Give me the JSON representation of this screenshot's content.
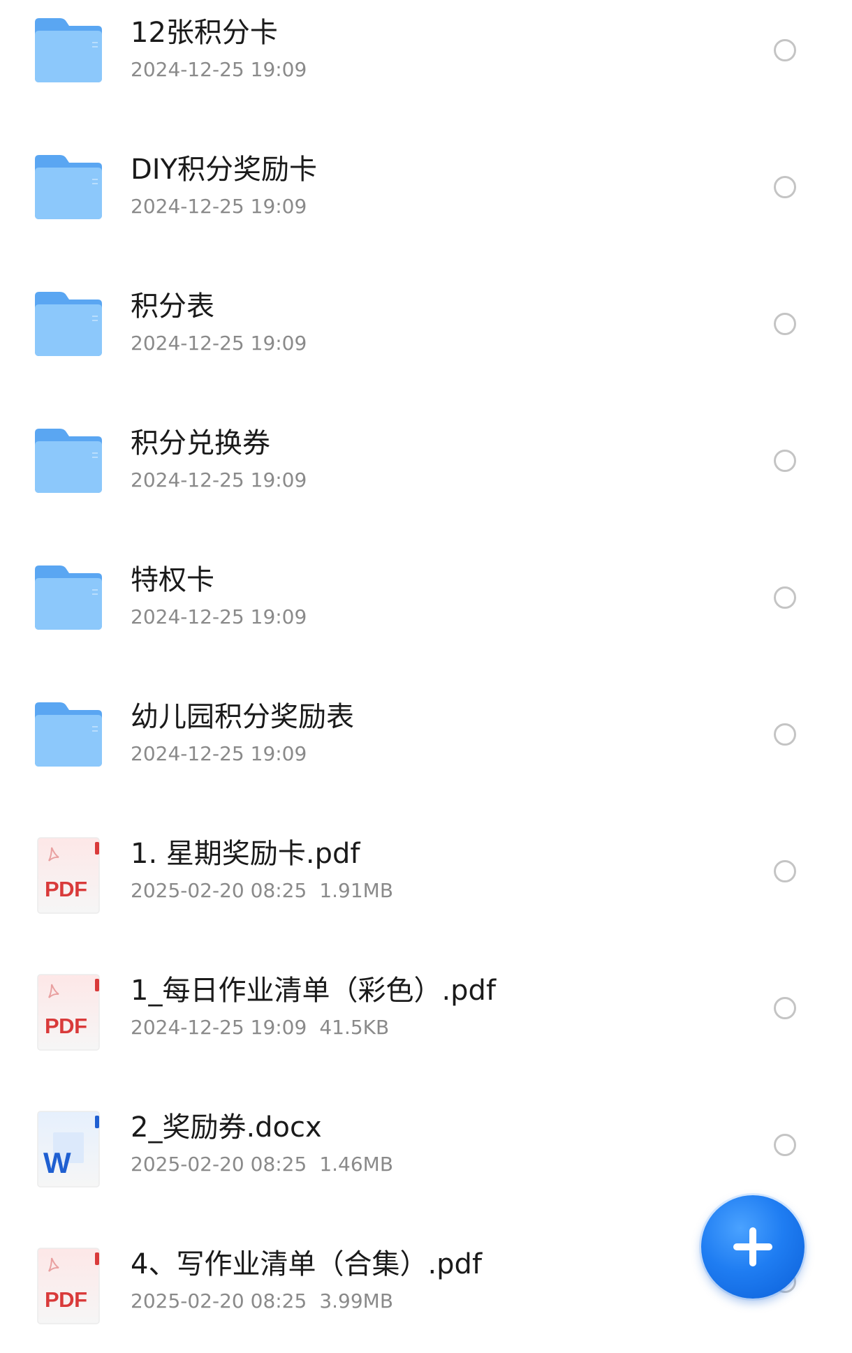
{
  "files": [
    {
      "type": "folder",
      "icon": "folder-icon",
      "name": "12张积分卡",
      "date": "2024-12-25 19:09",
      "size": ""
    },
    {
      "type": "folder",
      "icon": "folder-icon",
      "name": "DIY积分奖励卡",
      "date": "2024-12-25 19:09",
      "size": ""
    },
    {
      "type": "folder",
      "icon": "folder-icon",
      "name": "积分表",
      "date": "2024-12-25 19:09",
      "size": ""
    },
    {
      "type": "folder",
      "icon": "folder-icon",
      "name": "积分兑换券",
      "date": "2024-12-25 19:09",
      "size": ""
    },
    {
      "type": "folder",
      "icon": "folder-icon",
      "name": "特权卡",
      "date": "2024-12-25 19:09",
      "size": ""
    },
    {
      "type": "folder",
      "icon": "folder-icon",
      "name": "幼儿园积分奖励表",
      "date": "2024-12-25 19:09",
      "size": ""
    },
    {
      "type": "pdf",
      "icon": "pdf-file-icon",
      "badge": "PDF",
      "name": "1. 星期奖励卡.pdf",
      "date": "2025-02-20 08:25",
      "size": "1.91MB"
    },
    {
      "type": "pdf",
      "icon": "pdf-file-icon",
      "badge": "PDF",
      "name": "1_每日作业清单（彩色）.pdf",
      "date": "2024-12-25 19:09",
      "size": "41.5KB"
    },
    {
      "type": "word",
      "icon": "word-file-icon",
      "badge": "W",
      "name": "2_奖励券.docx",
      "date": "2025-02-20 08:25",
      "size": "1.46MB"
    },
    {
      "type": "pdf",
      "icon": "pdf-file-icon",
      "badge": "PDF",
      "name": "4、写作业清单（合集）.pdf",
      "date": "2025-02-20 08:25",
      "size": "3.99MB"
    }
  ],
  "fab": {
    "icon": "plus-icon"
  },
  "colors": {
    "folder": "#6db4f7",
    "pdf_badge": "#d93a3a",
    "word_badge": "#1f5fd1",
    "accent": "#1f7df2",
    "text_primary": "#1a1a1a",
    "text_secondary": "#8a8a8a",
    "radio_border": "#c4c4c4"
  }
}
